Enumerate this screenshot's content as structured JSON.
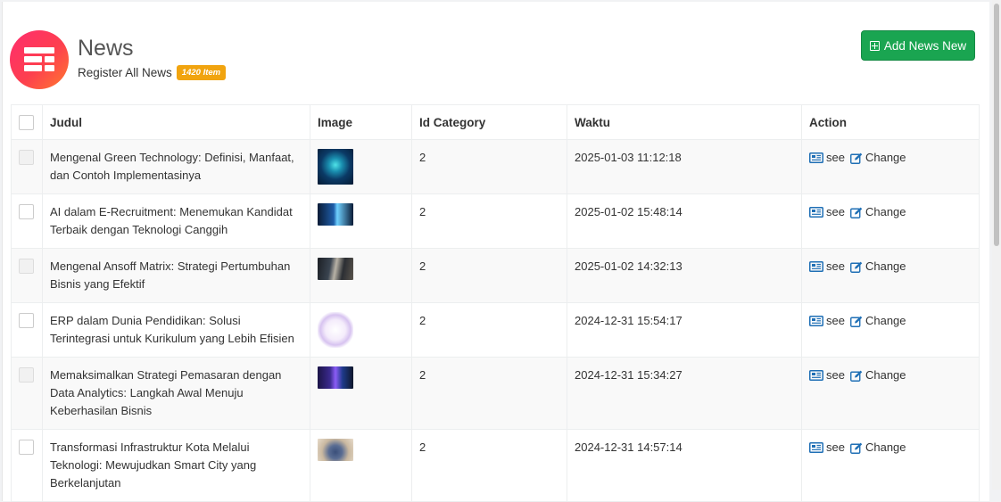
{
  "header": {
    "title": "News",
    "subtitle": "Register All News",
    "count_badge": "1420 Item",
    "add_button_label": "Add News New"
  },
  "table": {
    "columns": [
      "Judul",
      "Image",
      "Id Category",
      "Waktu",
      "Action"
    ],
    "action_see": "see",
    "action_change": "Change",
    "rows": [
      {
        "title": "Mengenal Green Technology: Definisi, Manfaat, dan Contoh Implementasinya",
        "category": "2",
        "time": "2025-01-03 11:12:18",
        "image": "green-tech-thumbnail"
      },
      {
        "title": "AI dalam E-Recruitment: Menemukan Kandidat Terbaik dengan Teknologi Canggih",
        "category": "2",
        "time": "2025-01-02 15:48:14",
        "image": "ai-recruitment-thumbnail"
      },
      {
        "title": "Mengenal Ansoff Matrix: Strategi Pertumbuhan Bisnis yang Efektif",
        "category": "2",
        "time": "2025-01-02 14:32:13",
        "image": "ansoff-matrix-thumbnail"
      },
      {
        "title": "ERP dalam Dunia Pendidikan: Solusi Terintegrasi untuk Kurikulum yang Lebih Efisien",
        "category": "2",
        "time": "2024-12-31 15:54:17",
        "image": "erp-education-thumbnail"
      },
      {
        "title": "Memaksimalkan Strategi Pemasaran dengan Data Analytics: Langkah Awal Menuju Keberhasilan Bisnis",
        "category": "2",
        "time": "2024-12-31 15:34:27",
        "image": "data-analytics-thumbnail"
      },
      {
        "title": "Transformasi Infrastruktur Kota Melalui Teknologi: Mewujudkan Smart City yang Berkelanjutan",
        "category": "2",
        "time": "2024-12-31 14:57:14",
        "image": "smart-city-thumbnail"
      }
    ]
  },
  "colors": {
    "accent_green": "#1aa551",
    "badge_orange": "#f1a40f",
    "icon_gradient_start": "#ff2d6e",
    "icon_gradient_end": "#ff7a2e",
    "link_blue": "#1f6fb5"
  }
}
